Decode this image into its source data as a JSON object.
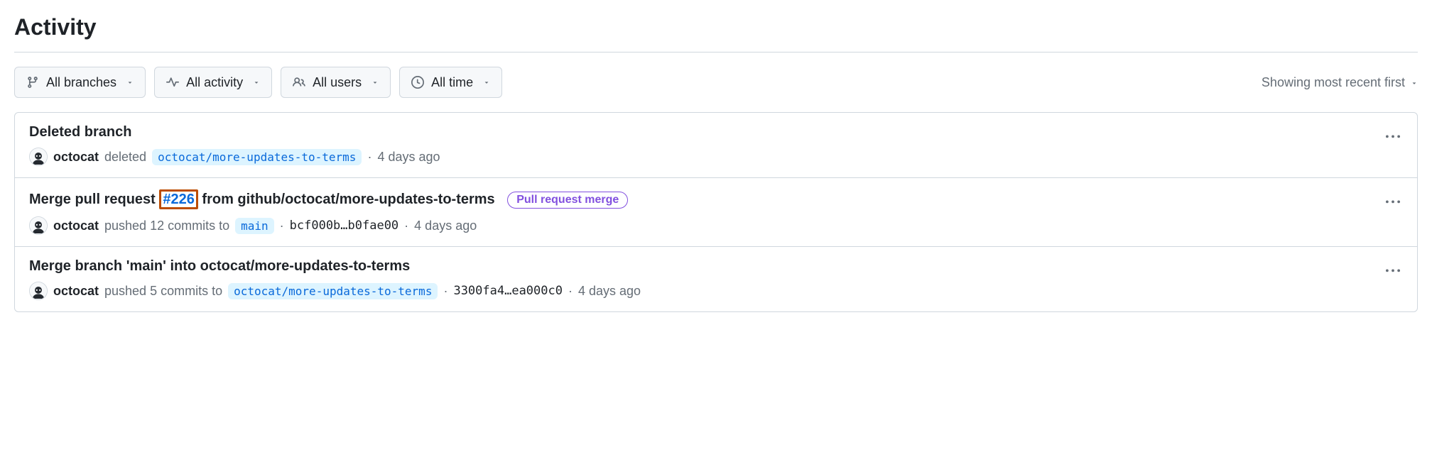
{
  "header": {
    "title": "Activity"
  },
  "filters": {
    "branches": "All branches",
    "activity": "All activity",
    "users": "All users",
    "time": "All time"
  },
  "sort": {
    "label": "Showing most recent first"
  },
  "items": [
    {
      "title_prefix": "Deleted branch",
      "pr_number": "",
      "title_suffix": "",
      "badge": "",
      "user": "octocat",
      "action": "deleted",
      "commits_text": "",
      "branch": "octocat/more-updates-to-terms",
      "sha": "",
      "time": "4 days ago"
    },
    {
      "title_prefix": "Merge pull request ",
      "pr_number": "#226",
      "title_suffix": " from github/octocat/more-updates-to-terms",
      "badge": "Pull request merge",
      "user": "octocat",
      "action": "pushed 12 commits to",
      "commits_text": "",
      "branch": "main",
      "sha": "bcf000b…b0fae00",
      "time": "4 days ago"
    },
    {
      "title_prefix": "Merge branch 'main' into octocat/more-updates-to-terms",
      "pr_number": "",
      "title_suffix": "",
      "badge": "",
      "user": "octocat",
      "action": "pushed 5 commits to",
      "commits_text": "",
      "branch": "octocat/more-updates-to-terms",
      "sha": "3300fa4…ea000c0",
      "time": "4 days ago"
    }
  ]
}
